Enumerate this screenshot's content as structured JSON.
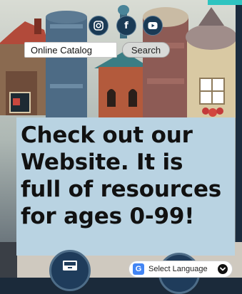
{
  "social": {
    "instagram_icon": "instagram-icon",
    "facebook_label": "f",
    "youtube_icon": "youtube-icon"
  },
  "search": {
    "placeholder": "Online Catalog",
    "button_label": "Search"
  },
  "promo": {
    "lines": [
      "Check out our",
      "Website. It is",
      "full of resources",
      "for ages 0-99!"
    ]
  },
  "language": {
    "label": "Select Language",
    "logo_letter": "G"
  },
  "colors": {
    "promo_bg": "#b9d3e2",
    "accent_teal": "#2ec4c0",
    "dark_navy": "#1f3c5b"
  }
}
